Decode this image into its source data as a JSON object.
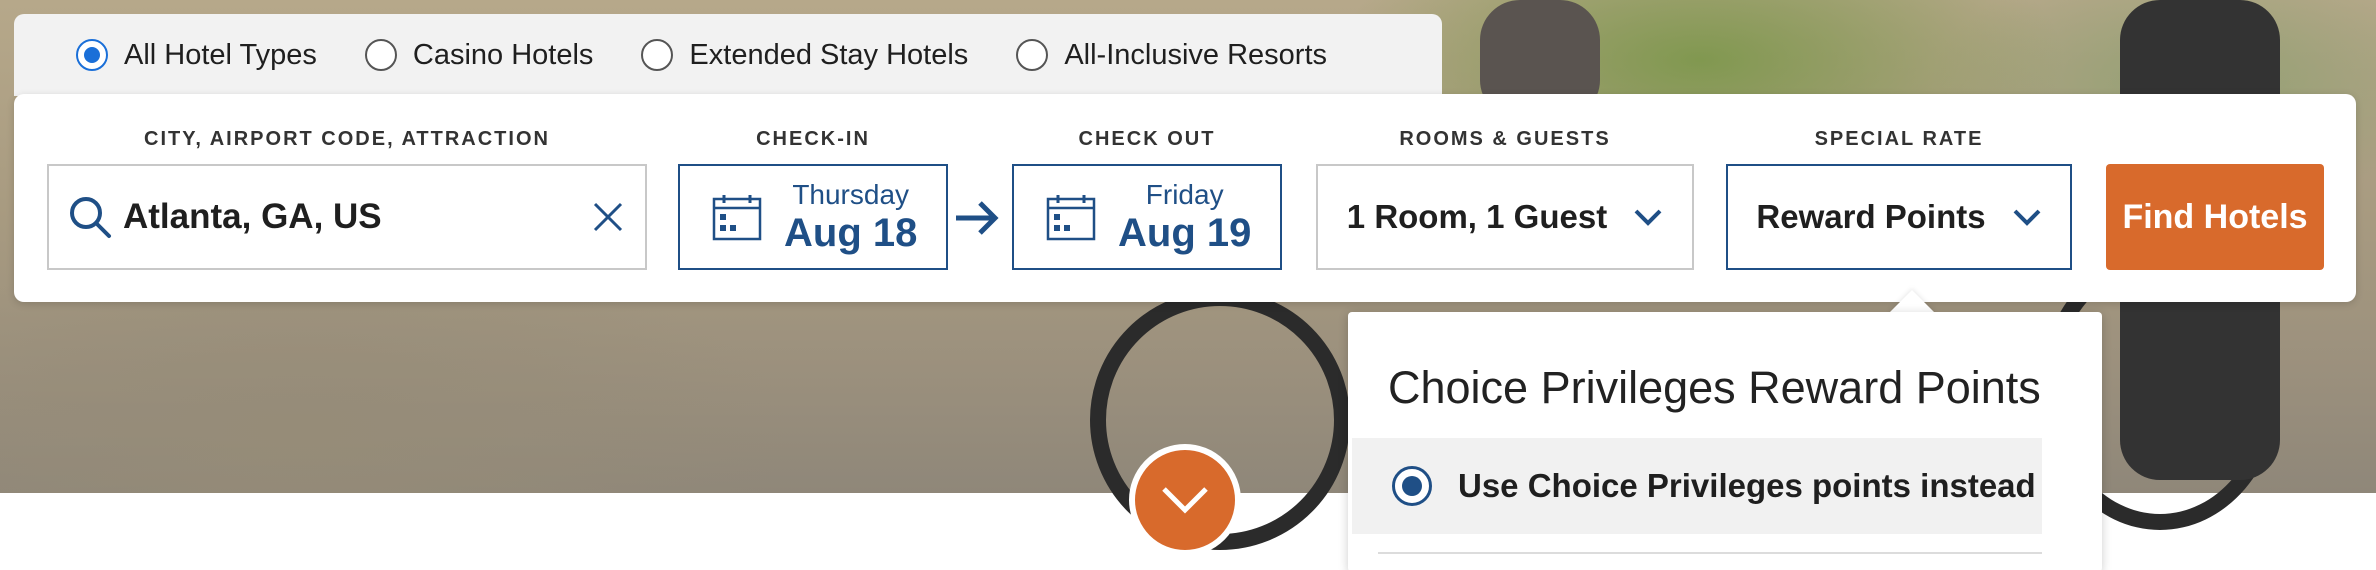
{
  "hotel_types": [
    {
      "label": "All Hotel Types",
      "checked": true
    },
    {
      "label": "Casino Hotels",
      "checked": false
    },
    {
      "label": "Extended Stay Hotels",
      "checked": false
    },
    {
      "label": "All-Inclusive Resorts",
      "checked": false
    }
  ],
  "search": {
    "destination_label": "CITY, AIRPORT CODE, ATTRACTION",
    "destination_value": "Atlanta, GA, US",
    "checkin_label": "CHECK-IN",
    "checkin_day": "Thursday",
    "checkin_date": "Aug 18",
    "checkout_label": "CHECK OUT",
    "checkout_day": "Friday",
    "checkout_date": "Aug 19",
    "rooms_label": "ROOMS & GUESTS",
    "rooms_value": "1 Room, 1 Guest",
    "rate_label": "SPECIAL RATE",
    "rate_value": "Reward Points",
    "find_button": "Find Hotels"
  },
  "dropdown": {
    "title": "Choice Privileges Reward Points",
    "option_label": "Use Choice Privileges points instead",
    "option_checked": true
  },
  "colors": {
    "accent_orange": "#d86a2c",
    "brand_blue": "#1f4f86",
    "radio_blue": "#1a6fd8"
  },
  "icons": {
    "search": "search-icon",
    "clear": "close-icon",
    "calendar": "calendar-icon",
    "arrow": "arrow-right-icon",
    "chevron": "chevron-down-icon"
  }
}
